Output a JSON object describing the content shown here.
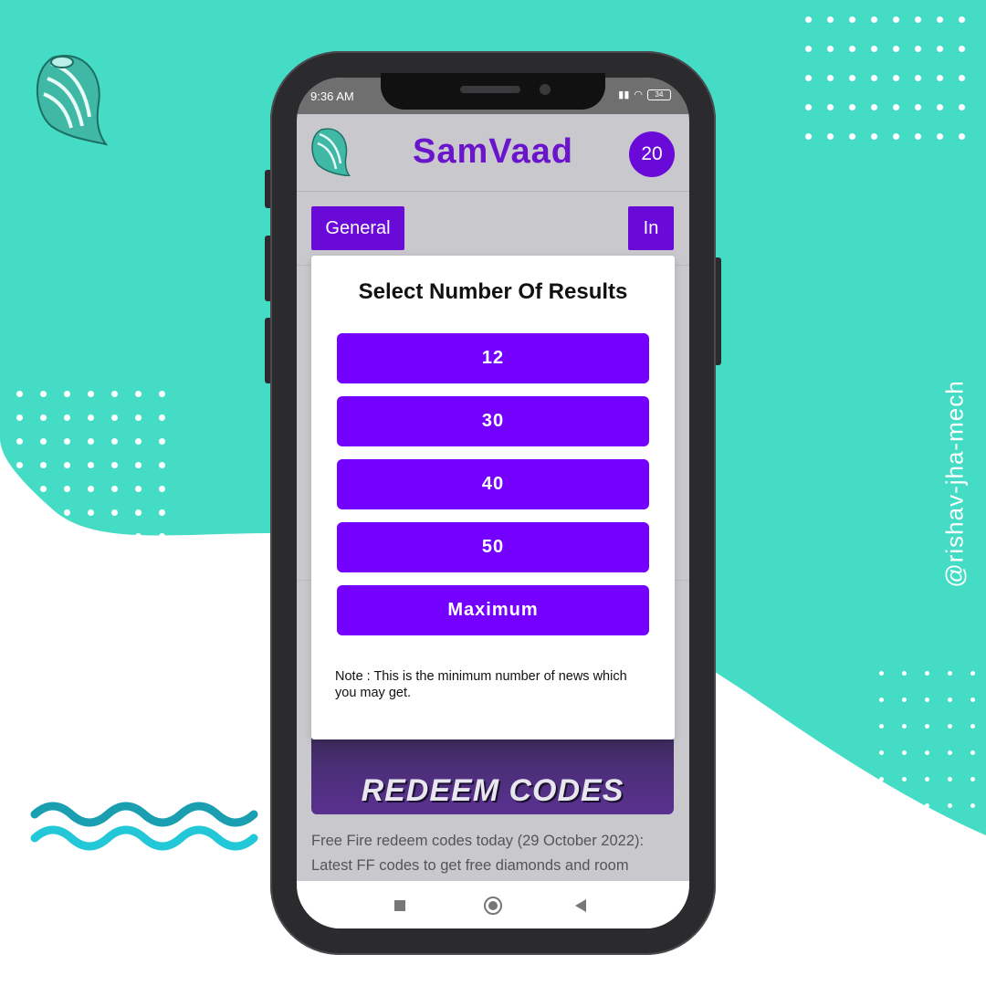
{
  "brand": {
    "accent": "#6a0ad8",
    "button": "#7400ff",
    "teal": "#45dcc6"
  },
  "watermark": "@rishav-jha-mech",
  "status_bar": {
    "time": "9:36 AM",
    "battery": "34"
  },
  "app": {
    "title": "SamVaad",
    "count": "20",
    "logo_icon": "shell-logo-icon"
  },
  "categories": [
    "General",
    "In"
  ],
  "dialog": {
    "title": "Select Number Of Results",
    "options": [
      "12",
      "30",
      "40",
      "50",
      "Maximum"
    ],
    "note": "Note :  This is the minimum number of news which you may get."
  },
  "feed": {
    "image_text": "REDEEM CODES",
    "headline": "Free Fire redeem codes today (29 October 2022): Latest FF codes to get free diamonds and room"
  },
  "nav": {
    "icons": [
      "recents-square-icon",
      "home-circle-icon",
      "back-triangle-icon"
    ]
  }
}
